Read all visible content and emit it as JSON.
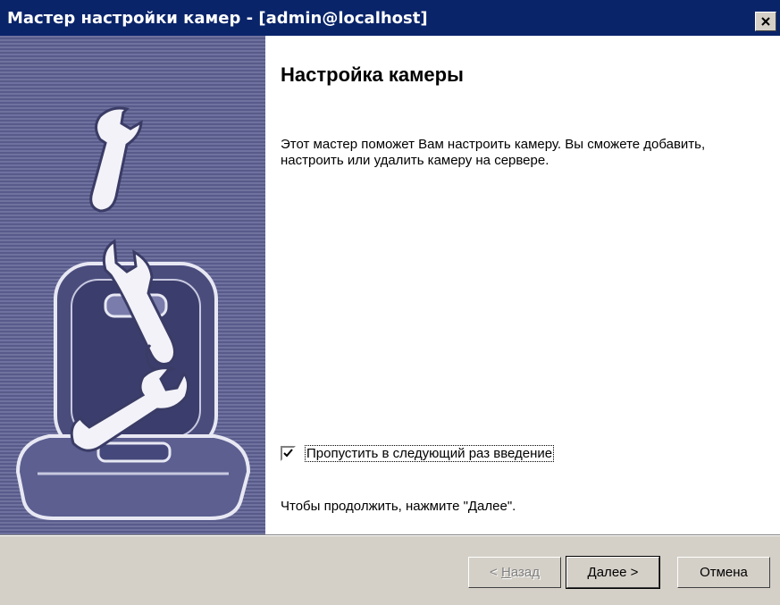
{
  "window": {
    "title": "Мастер настройки камер - [admin@localhost]"
  },
  "icons": {
    "close": "close-icon",
    "illustration": "toolbox-wrench-illustration",
    "check": "checkmark-icon"
  },
  "page": {
    "heading": "Настройка камеры",
    "description": "Этот мастер поможет Вам настроить камеру. Вы сможете добавить, настроить или удалить камеру на сервере.",
    "skip_intro": {
      "label": "Пропустить в следующий раз введение",
      "checked": true
    },
    "continue_hint": "Чтобы продолжить, нажмите \"Далее\"."
  },
  "buttons": {
    "back": {
      "prefix": "< ",
      "mnemonic": "Н",
      "rest": "азад",
      "enabled": false
    },
    "next": {
      "mnemonic": "Д",
      "rest": "алее >",
      "enabled": true
    },
    "cancel": {
      "label": "Отмена",
      "enabled": true
    }
  },
  "colors": {
    "titlebar": "#0a246a",
    "sidebar_light": "#6f729e",
    "sidebar_dark": "#585b8a",
    "face": "#d4d0c8"
  }
}
